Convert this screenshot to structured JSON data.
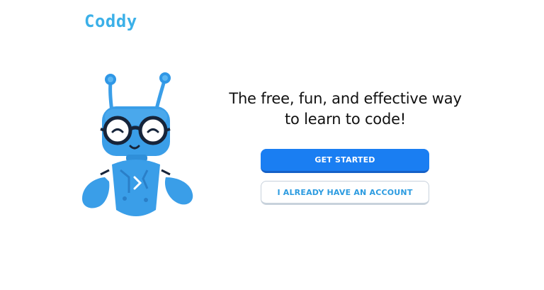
{
  "app": {
    "logo_text": "Coddy",
    "brand_color": "#3bb0e8"
  },
  "hero": {
    "headline_line1": "The free, fun, and effective way",
    "headline_line2": "to learn to code!",
    "mascot_icon": "robot-mascot-icon"
  },
  "actions": {
    "get_started_label": "GET STARTED",
    "have_account_label": "I ALREADY HAVE AN ACCOUNT",
    "primary_color": "#1a7ef2"
  }
}
